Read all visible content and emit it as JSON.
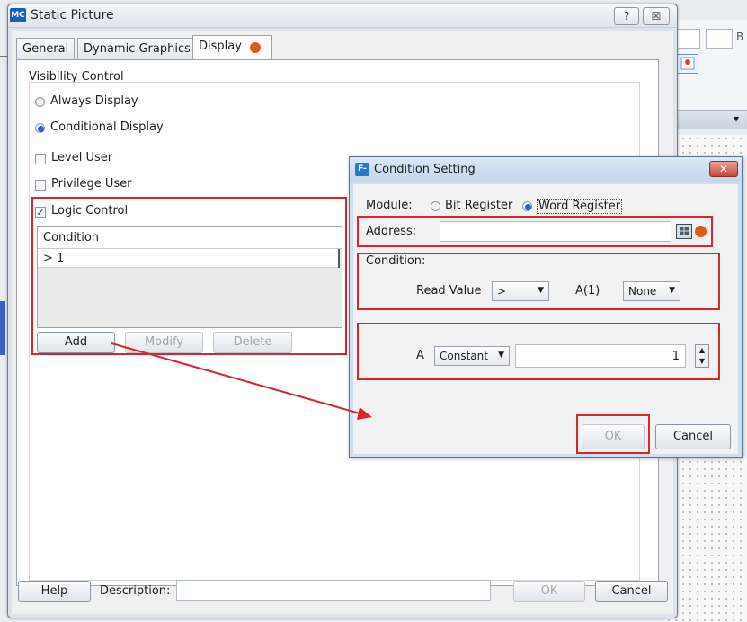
{
  "main_dialog": {
    "title": "Static Picture",
    "icon_text": "MC",
    "help_glyph": "?",
    "close_glyph": "☒",
    "tabs": [
      "General",
      "Dynamic Graphics",
      "Display"
    ],
    "visibility": {
      "group_label": "Visibility Control",
      "always": "Always Display",
      "conditional": "Conditional Display",
      "level_user": "Level User",
      "privilege_user": "Privilege User",
      "logic_control": "Logic Control",
      "condition_header": "Condition",
      "condition_row": "> 1",
      "add": "Add",
      "modify": "Modify",
      "delete": "Delete"
    },
    "footer": {
      "help": "Help",
      "description_label": "Description:",
      "description_value": "",
      "ok": "OK",
      "cancel": "Cancel"
    }
  },
  "condition_dialog": {
    "title": "Condition Setting",
    "icon_text": "F-",
    "close_glyph": "✕",
    "module_label": "Module:",
    "bit_register": "Bit Register",
    "word_register": "Word Register",
    "address_label": "Address:",
    "address_value": "",
    "condition_label": "Condition:",
    "read_value_label": "Read Value",
    "operator": ">",
    "a1_label": "A(1)",
    "a1_value": "None",
    "a_label": "A",
    "a_type": "Constant",
    "a_value": "1",
    "ok": "OK",
    "cancel": "Cancel"
  },
  "background_app": {
    "combo_letter": "B"
  },
  "colors": {
    "highlight_red": "#d7262f",
    "radio_selected": "#2a62c8"
  }
}
